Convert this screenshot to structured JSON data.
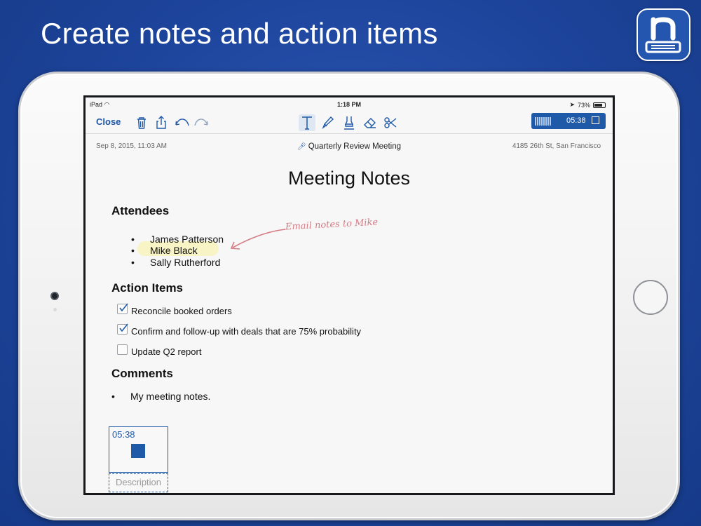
{
  "headline": "Create notes and action items",
  "status_bar": {
    "device": "iPad",
    "time": "1:18 PM",
    "battery": "73%"
  },
  "toolbar": {
    "close_label": "Close",
    "recorder_time": "05:38"
  },
  "meta": {
    "date": "Sep 8, 2015, 11:03 AM",
    "title": "Quarterly Review Meeting",
    "location": "4185 26th St, San Francisco"
  },
  "note": {
    "title": "Meeting Notes",
    "attendees_heading": "Attendees",
    "attendees": [
      "James Patterson",
      "Mike Black",
      "Sally Rutherford"
    ],
    "bullet_glyph": "•",
    "annotation": "Email notes to Mike",
    "action_items_heading": "Action Items",
    "action_items": [
      {
        "label": "Reconcile booked orders",
        "checked": true
      },
      {
        "label": "Confirm and follow-up with deals that are 75% probability",
        "checked": true
      },
      {
        "label": "Update Q2 report",
        "checked": false
      }
    ],
    "comments_heading": "Comments",
    "comments": [
      "My meeting notes."
    ]
  },
  "audio_clip": {
    "time": "05:38",
    "description_placeholder": "Description"
  },
  "colors": {
    "accent": "#1f5aa8",
    "background": "#1d449b",
    "highlight": "#f7f3bf",
    "ink": "#d47b84"
  },
  "icons": [
    "app-logo-icon",
    "wifi-icon",
    "location-icon",
    "battery-icon",
    "trash-icon",
    "share-icon",
    "undo-icon",
    "redo-icon",
    "text-tool-icon",
    "pen-tool-icon",
    "highlighter-tool-icon",
    "eraser-tool-icon",
    "scissors-tool-icon",
    "microphone-icon",
    "stop-icon",
    "checkmark-icon"
  ]
}
